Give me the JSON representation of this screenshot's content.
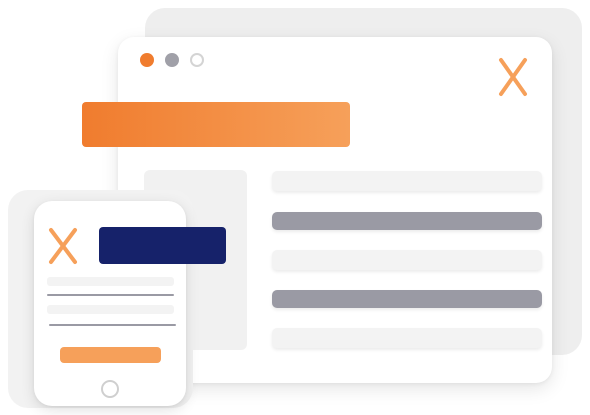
{
  "colors": {
    "accent_orange": "#f07c2e",
    "accent_orange_light": "#f6a05a",
    "navy": "#16226a",
    "gray_bar": "#9a9aa4",
    "dot_orange": "#f07c2e",
    "dot_gray": "#a0a0a8"
  },
  "browser": {
    "window_controls": [
      "orange-dot",
      "gray-dot",
      "white-dot"
    ],
    "logo_icon": "x-mark-icon",
    "content_lines": [
      "light",
      "dark",
      "light",
      "dark",
      "light"
    ]
  },
  "mobile": {
    "logo_icon": "x-mark-icon",
    "content_lines": [
      "light",
      "rule",
      "light",
      "rule"
    ]
  }
}
